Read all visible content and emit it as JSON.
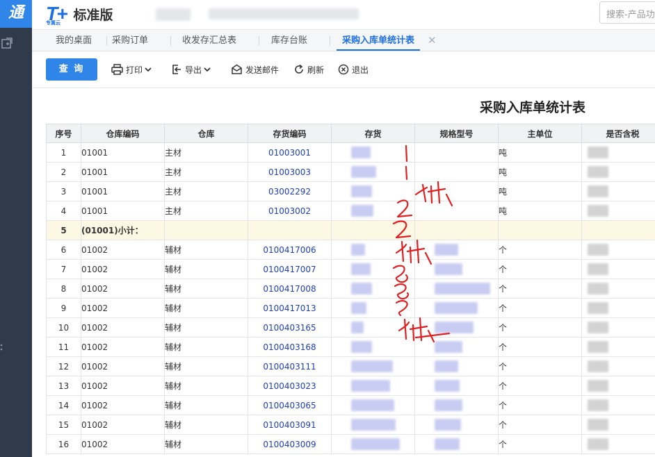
{
  "app": {
    "logo_glyph": "通",
    "brand_mark": "T+",
    "brand_sub": "专属云",
    "brand_name": "标准版",
    "search_placeholder": "搜索-产品功"
  },
  "tabs": [
    {
      "label": "我的桌面"
    },
    {
      "label": "采购订单"
    },
    {
      "label": "收发存汇总表"
    },
    {
      "label": "库存台账"
    },
    {
      "label": "采购入库单统计表",
      "active": true,
      "close_icon": "close-icon"
    }
  ],
  "toolbar": {
    "query_label": "查 询",
    "print_label": "打印",
    "export_label": "导出",
    "email_label": "发送邮件",
    "refresh_label": "刷新",
    "exit_label": "退出"
  },
  "report": {
    "title": "采购入库单统计表",
    "columns": [
      "序号",
      "仓库编码",
      "仓库",
      "存货编码",
      "存货",
      "规格型号",
      "主单位",
      "是否含税"
    ],
    "rows": [
      {
        "no": "1",
        "wh_code": "01001",
        "wh": "主材",
        "code": "01003001",
        "unit": "吨"
      },
      {
        "no": "2",
        "wh_code": "01001",
        "wh": "主材",
        "code": "01003003",
        "unit": "吨"
      },
      {
        "no": "3",
        "wh_code": "01001",
        "wh": "主材",
        "code": "03002292",
        "unit": "吨"
      },
      {
        "no": "4",
        "wh_code": "01001",
        "wh": "主材",
        "code": "01003002",
        "unit": "吨"
      },
      {
        "no": "5",
        "subtotal": "(01001)小计："
      },
      {
        "no": "6",
        "wh_code": "01002",
        "wh": "辅材",
        "code": "0100417006",
        "unit": "个"
      },
      {
        "no": "7",
        "wh_code": "01002",
        "wh": "辅材",
        "code": "0100417007",
        "unit": "个"
      },
      {
        "no": "8",
        "wh_code": "01002",
        "wh": "辅材",
        "code": "0100417008",
        "unit": "个"
      },
      {
        "no": "9",
        "wh_code": "01002",
        "wh": "辅材",
        "code": "0100417013",
        "unit": "个"
      },
      {
        "no": "10",
        "wh_code": "01002",
        "wh": "辅材",
        "code": "0100403165",
        "unit": "个"
      },
      {
        "no": "11",
        "wh_code": "01002",
        "wh": "辅材",
        "code": "0100403168",
        "unit": "个"
      },
      {
        "no": "12",
        "wh_code": "01002",
        "wh": "辅材",
        "code": "0100403111",
        "unit": "个"
      },
      {
        "no": "13",
        "wh_code": "01002",
        "wh": "辅材",
        "code": "0100403023",
        "unit": "个"
      },
      {
        "no": "14",
        "wh_code": "01002",
        "wh": "辅材",
        "code": "0100403065",
        "unit": "个"
      },
      {
        "no": "15",
        "wh_code": "01002",
        "wh": "辅材",
        "code": "0100403091",
        "unit": "个"
      },
      {
        "no": "16",
        "wh_code": "01002",
        "wh": "辅材",
        "code": "0100403009",
        "unit": "个"
      }
    ]
  },
  "annotations": {
    "marks": [
      "1",
      "小计",
      "2",
      "小计",
      "3",
      "小计"
    ],
    "color": "#e02020"
  },
  "colors": {
    "accent": "#2f86e8",
    "rail": "#2f3a4a",
    "code_text": "#1e3fb8",
    "subtotal_bg": "#fdf8e3"
  }
}
